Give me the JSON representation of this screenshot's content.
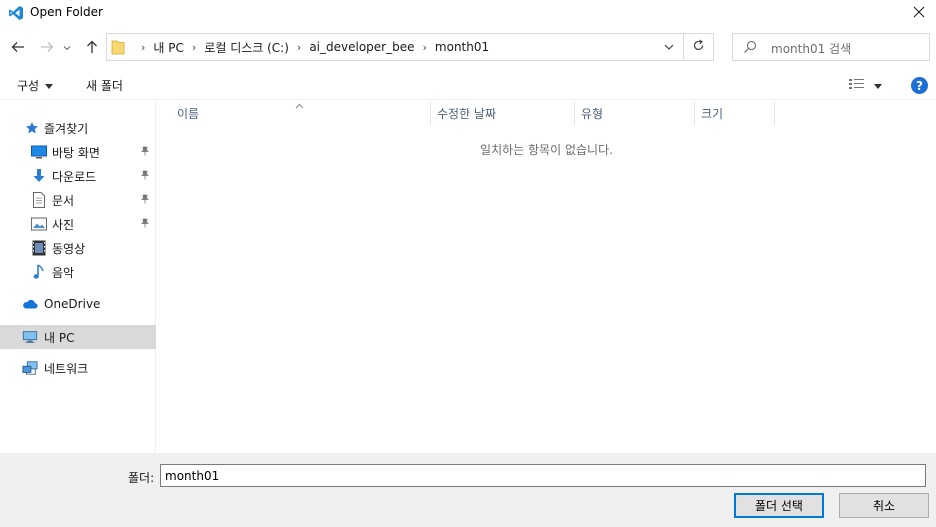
{
  "window": {
    "title": "Open Folder",
    "icon": "vscode-icon"
  },
  "nav": {
    "breadcrumbs": [
      "내 PC",
      "로컬 디스크 (C:)",
      "ai_developer_bee",
      "month01"
    ],
    "search_placeholder": "month01 검색"
  },
  "toolbar": {
    "organize_label": "구성",
    "new_folder_label": "새 폴더",
    "help_label": "?"
  },
  "sidebar": {
    "quick_access_label": "즐겨찾기",
    "quick_items": [
      {
        "label": "바탕 화면",
        "icon": "desktop-icon",
        "pinned": true
      },
      {
        "label": "다운로드",
        "icon": "download-icon",
        "pinned": true
      },
      {
        "label": "문서",
        "icon": "document-icon",
        "pinned": true
      },
      {
        "label": "사진",
        "icon": "pictures-icon",
        "pinned": true
      },
      {
        "label": "동영상",
        "icon": "video-icon",
        "pinned": false
      },
      {
        "label": "음악",
        "icon": "music-icon",
        "pinned": false
      }
    ],
    "onedrive_label": "OneDrive",
    "this_pc_label": "내 PC",
    "network_label": "네트워크"
  },
  "content": {
    "columns": [
      "이름",
      "수정한 날짜",
      "유형",
      "크기"
    ],
    "empty_message": "일치하는 항목이 없습니다."
  },
  "footer": {
    "folder_label": "폴더:",
    "folder_value": "month01",
    "select_button": "폴더 선택",
    "cancel_button": "취소"
  },
  "colors": {
    "accent": "#0078d7",
    "selected_bg": "#d9d9d9",
    "footer_bg": "#f0f0f0",
    "header_text": "#4c607a"
  }
}
